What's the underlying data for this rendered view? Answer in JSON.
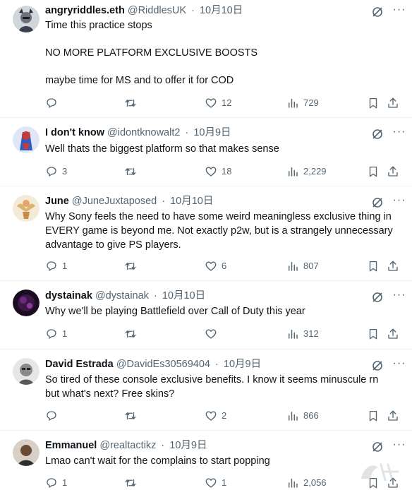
{
  "tweets": [
    {
      "name": "angryriddles.eth",
      "handle": "@RiddlesUK",
      "date": "10月10日",
      "lines": [
        "Time this practice stops",
        "NO MORE PLATFORM EXCLUSIVE BOOSTS",
        "maybe time for MS and to offer it for COD"
      ],
      "replies": "",
      "retweets": "",
      "likes": "12",
      "views": "729",
      "avatar_color": "#3a3f52"
    },
    {
      "name": "I don't know",
      "handle": "@idontknowalt2",
      "date": "10月9日",
      "lines": [
        "Well thats the biggest platform so that makes sense"
      ],
      "replies": "3",
      "retweets": "",
      "likes": "18",
      "views": "2,229",
      "avatar_color": "#2c5cc5"
    },
    {
      "name": "June",
      "handle": "@JuneJuxtaposed",
      "date": "10月10日",
      "lines": [
        "Why Sony feels the need to have some weird meaningless exclusive thing in",
        "EVERY game is beyond me. Not exactly p2w, but is a strangely unnecessary",
        "advantage to give PS players."
      ],
      "replies": "1",
      "retweets": "",
      "likes": "6",
      "views": "807",
      "avatar_color": "#d9b46a"
    },
    {
      "name": "dystainak",
      "handle": "@dystainak",
      "date": "10月10日",
      "lines": [
        "Why we'll be playing Battlefield over Call of Duty this year"
      ],
      "replies": "1",
      "retweets": "",
      "likes": "",
      "views": "312",
      "avatar_color": "#3b1846"
    },
    {
      "name": "David Estrada",
      "handle": "@DavidEs30569404",
      "date": "10月9日",
      "lines": [
        "So tired of these console exclusive benefits. I know it seems minuscule rn",
        "but what's next? Free skins?"
      ],
      "replies": "",
      "retweets": "",
      "likes": "2",
      "views": "866",
      "avatar_color": "#8a8a8a"
    },
    {
      "name": "Emmanuel",
      "handle": "@realtactikz",
      "date": "10月9日",
      "lines": [
        "Lmao can't wait for the complains to start popping"
      ],
      "replies": "1",
      "retweets": "",
      "likes": "1",
      "views": "2,056",
      "avatar_color": "#6b4a33"
    }
  ],
  "icons": {
    "reply": "reply-icon",
    "retweet": "retweet-icon",
    "like": "heart-icon",
    "views": "views-icon",
    "bookmark": "bookmark-icon",
    "share": "share-icon",
    "grok": "grok-icon",
    "more": "more-icon"
  },
  "colors": {
    "text": "#0f1419",
    "secondary": "#536471",
    "divider": "#eff3f4"
  }
}
